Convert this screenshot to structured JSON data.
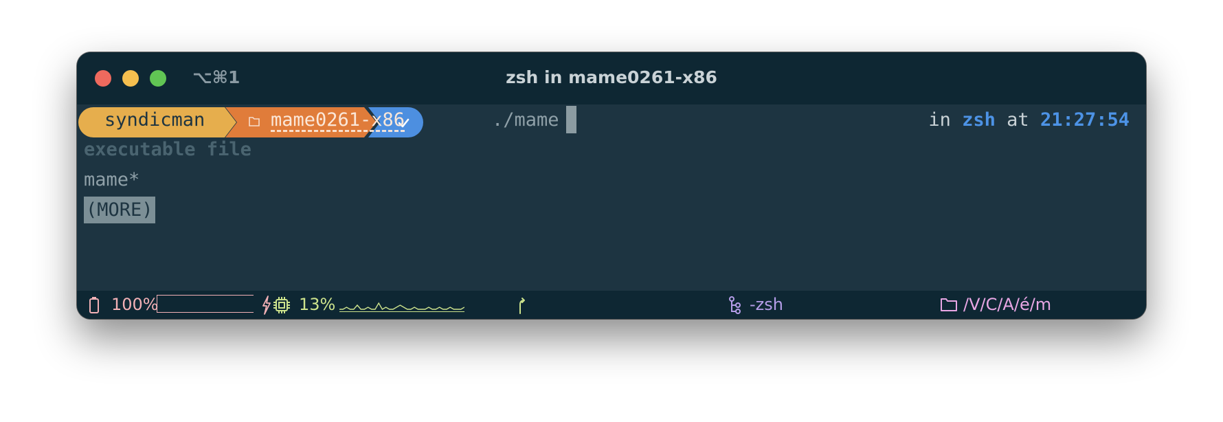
{
  "window": {
    "tab_shortcut": "⌥⌘1",
    "title": "zsh in mame0261-x86"
  },
  "prompt": {
    "user": "syndicman",
    "directory": "mame0261-x86",
    "status_icon": "check-icon",
    "command": "./mame",
    "right_in_label": "in",
    "right_shell": "zsh",
    "right_at_label": "at",
    "right_time": "21:27:54"
  },
  "completion": {
    "heading": "executable file",
    "items": [
      "mame*"
    ],
    "more_label": "(MORE)"
  },
  "statusbar": {
    "battery_pct": "100%",
    "battery_level": 1.0,
    "cpu_pct": "13%",
    "cpu_history": [
      1,
      1,
      2,
      1,
      1,
      3,
      1,
      1,
      2,
      1,
      1,
      4,
      1,
      2,
      1,
      1,
      2,
      3,
      2,
      1,
      1,
      2,
      1,
      1,
      1,
      2,
      1,
      1,
      2,
      1,
      1,
      2,
      1,
      1,
      1,
      2
    ],
    "job_label": "-zsh",
    "path_label": "/V/C/A/é/m"
  },
  "colors": {
    "user_segment": "#e6ae4d",
    "dir_segment": "#e07c3a",
    "status_segment": "#4d8fe0",
    "accent_blue": "#4d93e6"
  }
}
